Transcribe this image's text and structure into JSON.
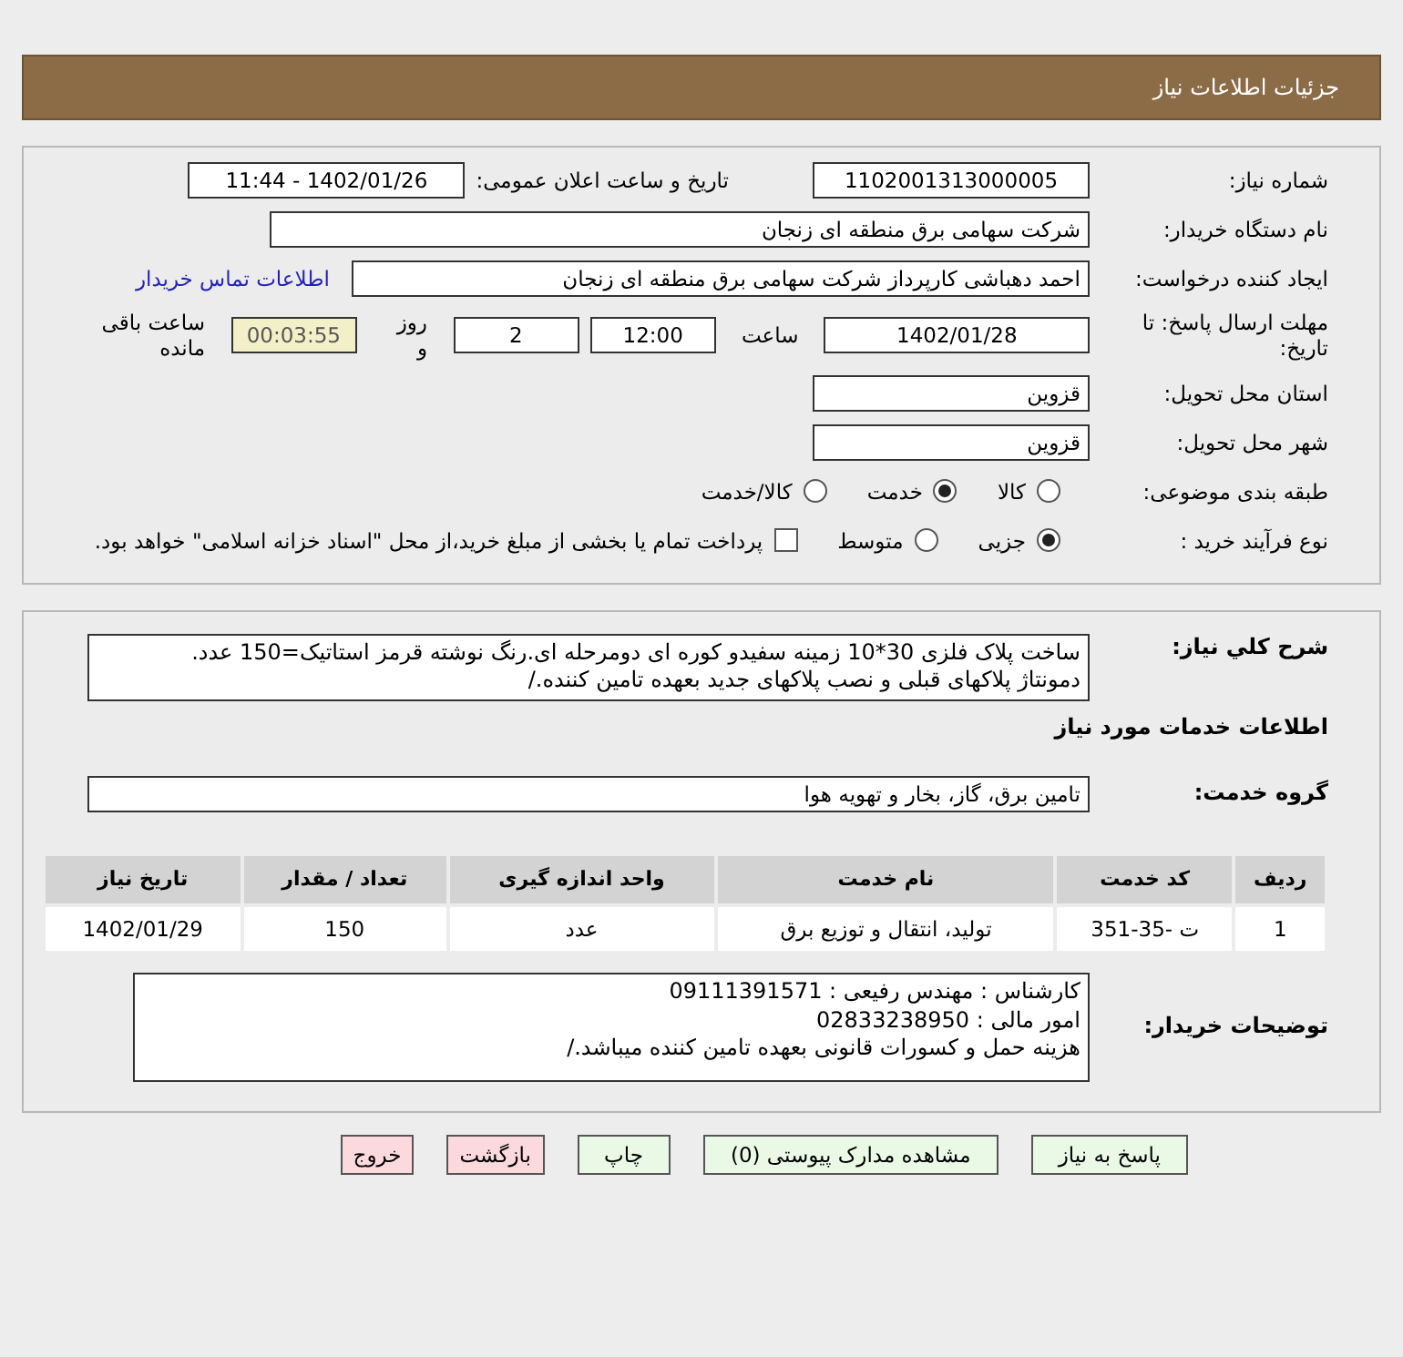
{
  "header": {
    "title": "جزئیات اطلاعات نیاز"
  },
  "details": {
    "need_number": {
      "label": "شماره نیاز:",
      "value": "1102001313000005"
    },
    "announce": {
      "label": "تاریخ و ساعت اعلان عمومی:",
      "value": "1402/01/26 - 11:44"
    },
    "buyer": {
      "label": "نام دستگاه خریدار:",
      "value": "شرکت سهامی برق منطقه ای زنجان"
    },
    "creator": {
      "label": "ایجاد کننده درخواست:",
      "value": "احمد دهباشی کارپرداز شرکت سهامی برق منطقه ای زنجان",
      "link": "اطلاعات تماس خریدار"
    },
    "deadline": {
      "label": "مهلت ارسال پاسخ: تا تاریخ:",
      "date": "1402/01/28",
      "time_label": "ساعت",
      "time": "12:00",
      "days": "2",
      "days_label": "روز و",
      "remaining": "00:03:55",
      "remaining_label": "ساعت باقی مانده"
    },
    "province": {
      "label": "استان محل تحویل:",
      "value": "قزوین"
    },
    "city": {
      "label": "شهر محل تحویل:",
      "value": "قزوین"
    },
    "category": {
      "label": "طبقه بندی موضوعی:",
      "options": [
        {
          "label": "کالا",
          "selected": false
        },
        {
          "label": "خدمت",
          "selected": true
        },
        {
          "label": "کالا/خدمت",
          "selected": false
        }
      ]
    },
    "process": {
      "label": "نوع فرآیند خرید :",
      "options": [
        {
          "label": "جزیی",
          "selected": true
        },
        {
          "label": "متوسط",
          "selected": false
        }
      ],
      "treasury": {
        "label": "پرداخت تمام یا بخشی از مبلغ خرید،از محل \"اسناد خزانه اسلامی\" خواهد بود.",
        "checked": false
      }
    }
  },
  "services": {
    "description": {
      "label": "شرح کلي نیاز:",
      "lines": [
        "ساخت پلاک فلزی 30*10 زمینه سفیدو کوره ای دومرحله ای.رنگ نوشته قرمز استاتیک=150 عدد.",
        "دمونتاژ پلاکهای قبلی و نصب پلاکهای جدید بعهده تامین کننده./"
      ]
    },
    "section_title": "اطلاعات خدمات مورد نیاز",
    "group": {
      "label": "گروه خدمت:",
      "value": "تامین برق، گاز، بخار و تهویه هوا"
    },
    "table": {
      "columns": [
        "ردیف",
        "کد خدمت",
        "نام خدمت",
        "واحد اندازه گیری",
        "تعداد / مقدار",
        "تاریخ نیاز"
      ],
      "rows": [
        [
          "1",
          "ت -35-351",
          "تولید، انتقال و توزیع برق",
          "عدد",
          "150",
          "1402/01/29"
        ]
      ]
    },
    "notes": {
      "label": "توضیحات خریدار:",
      "lines": [
        "کارشناس : مهندس رفیعی : 09111391571",
        "امور مالی : 02833238950",
        "هزینه حمل و کسورات قانونی بعهده تامین کننده میباشد./"
      ]
    }
  },
  "buttons": [
    {
      "label": "پاسخ به نیاز",
      "kind": "normal"
    },
    {
      "label": "مشاهده مدارک پیوستی (0)",
      "kind": "normal"
    },
    {
      "label": "چاپ",
      "kind": "normal"
    },
    {
      "label": "بازگشت",
      "kind": "danger"
    },
    {
      "label": "خروج",
      "kind": "danger"
    }
  ]
}
